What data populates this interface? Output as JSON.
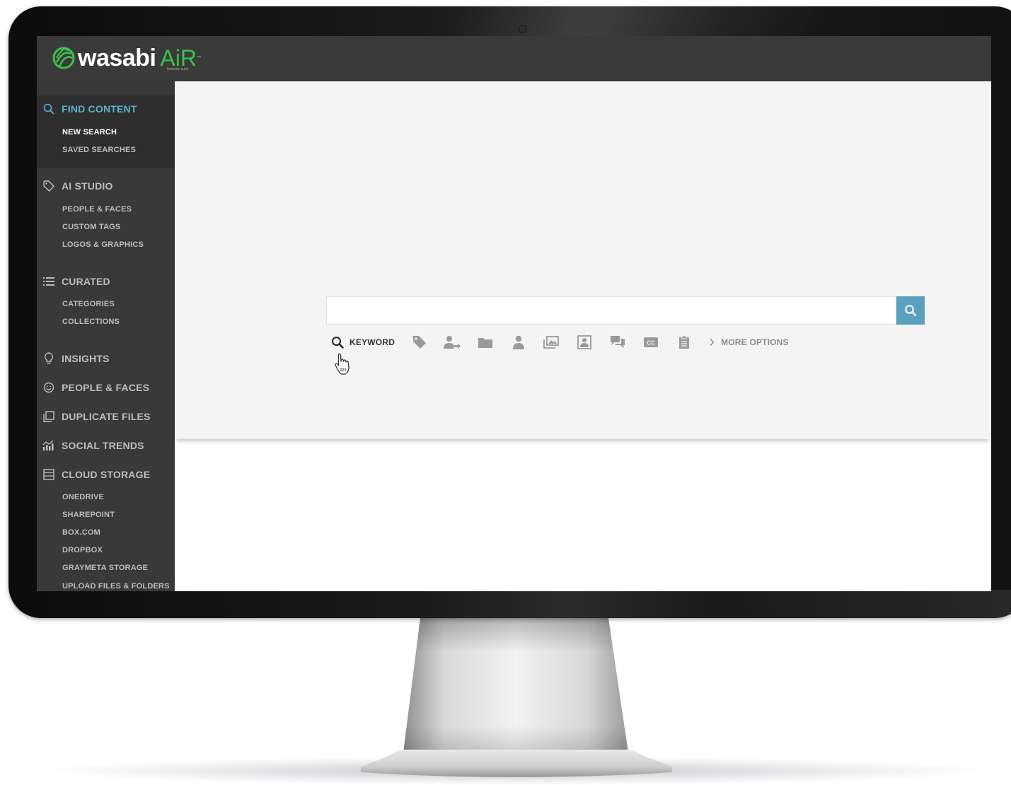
{
  "brand": {
    "name": "wasabi",
    "product": "AiR",
    "trademark": "™",
    "tagline": "formerly curio",
    "accent_color": "#3bc14a"
  },
  "sidebar": {
    "sections": [
      {
        "label": "FIND CONTENT",
        "icon": "search-icon",
        "active": true,
        "items": [
          {
            "label": "NEW SEARCH",
            "active": true
          },
          {
            "label": "SAVED SEARCHES"
          }
        ]
      },
      {
        "label": "AI STUDIO",
        "icon": "tag-icon",
        "items": [
          {
            "label": "PEOPLE & FACES"
          },
          {
            "label": "CUSTOM TAGS"
          },
          {
            "label": "LOGOS & GRAPHICS"
          }
        ]
      },
      {
        "label": "CURATED",
        "icon": "list-icon",
        "items": [
          {
            "label": "CATEGORIES"
          },
          {
            "label": "COLLECTIONS"
          }
        ]
      },
      {
        "label": "INSIGHTS",
        "icon": "lightbulb-icon",
        "items": []
      },
      {
        "label": "PEOPLE & FACES",
        "icon": "smiley-icon",
        "items": []
      },
      {
        "label": "DUPLICATE FILES",
        "icon": "copy-icon",
        "items": []
      },
      {
        "label": "SOCIAL TRENDS",
        "icon": "trends-chart-icon",
        "items": []
      },
      {
        "label": "CLOUD STORAGE",
        "icon": "storage-icon",
        "items": [
          {
            "label": "ONEDRIVE"
          },
          {
            "label": "SHAREPOINT"
          },
          {
            "label": "BOX.COM"
          },
          {
            "label": "DROPBOX"
          },
          {
            "label": "GRAYMETA STORAGE"
          },
          {
            "label": "UPLOAD FILES & FOLDERS"
          }
        ]
      }
    ],
    "active_color": "#5ab2cc"
  },
  "search": {
    "value": "",
    "placeholder": "",
    "button_icon": "search-icon",
    "button_color": "#5aa0bf"
  },
  "search_options": {
    "keyword": {
      "label": "KEYWORD",
      "icon": "search-icon"
    },
    "filters": [
      {
        "icon": "tag-icon"
      },
      {
        "icon": "person-arrow-icon"
      },
      {
        "icon": "folder-icon"
      },
      {
        "icon": "person-icon"
      },
      {
        "icon": "images-icon"
      },
      {
        "icon": "picture-person-icon"
      },
      {
        "icon": "chat-bubbles-icon"
      },
      {
        "icon": "closed-caption-icon"
      },
      {
        "icon": "clipboard-icon"
      }
    ],
    "more": {
      "label": "MORE OPTIONS",
      "icon": "chevron-right-icon"
    }
  }
}
